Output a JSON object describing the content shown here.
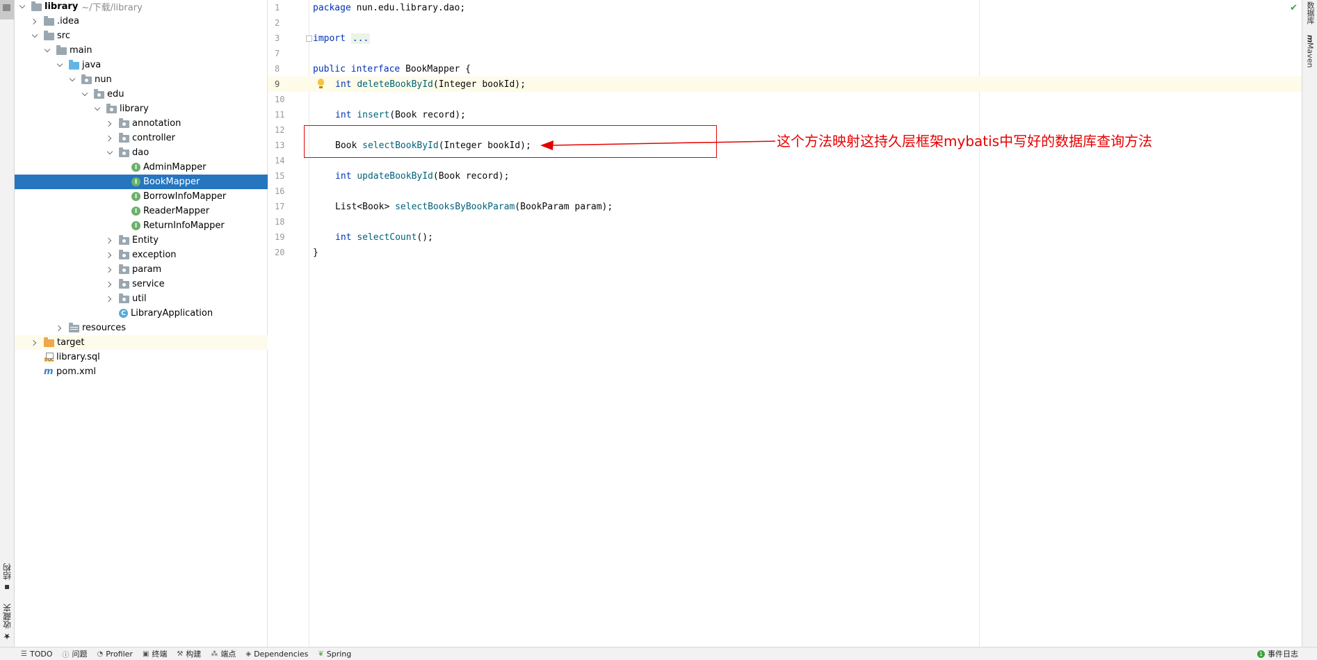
{
  "project_tree": {
    "root": {
      "label": "library",
      "path": "~/下载/library"
    },
    "items": [
      {
        "label": ".idea"
      },
      {
        "label": "src"
      },
      {
        "label": "main"
      },
      {
        "label": "java"
      },
      {
        "label": "nun"
      },
      {
        "label": "edu"
      },
      {
        "label": "library"
      },
      {
        "label": "annotation"
      },
      {
        "label": "controller"
      },
      {
        "label": "dao"
      },
      {
        "label": "AdminMapper"
      },
      {
        "label": "BookMapper"
      },
      {
        "label": "BorrowInfoMapper"
      },
      {
        "label": "ReaderMapper"
      },
      {
        "label": "ReturnInfoMapper"
      },
      {
        "label": "Entity"
      },
      {
        "label": "exception"
      },
      {
        "label": "param"
      },
      {
        "label": "service"
      },
      {
        "label": "util"
      },
      {
        "label": "LibraryApplication"
      },
      {
        "label": "resources"
      },
      {
        "label": "target"
      },
      {
        "label": "library.sql"
      },
      {
        "label": "pom.xml"
      }
    ]
  },
  "editor": {
    "lines": [
      {
        "n": "1"
      },
      {
        "n": "2"
      },
      {
        "n": "3"
      },
      {
        "n": "7"
      },
      {
        "n": "8"
      },
      {
        "n": "9"
      },
      {
        "n": "10"
      },
      {
        "n": "11"
      },
      {
        "n": "12"
      },
      {
        "n": "13"
      },
      {
        "n": "14"
      },
      {
        "n": "15"
      },
      {
        "n": "16"
      },
      {
        "n": "17"
      },
      {
        "n": "18"
      },
      {
        "n": "19"
      },
      {
        "n": "20"
      }
    ],
    "tokens": {
      "package_kw": "package",
      "package_name": " nun.edu.library.dao;",
      "import_kw": "import",
      "import_folded": "...",
      "public_kw": "public",
      "interface_kw": "interface",
      "class_decl": " BookMapper {",
      "int_kw": "int",
      "delete_fn": "deleteBookById",
      "delete_args": "(Integer bookId);",
      "insert_fn": "insert",
      "insert_args": "(Book record);",
      "book_type": "Book",
      "select_fn": "selectBookById",
      "select_args": "(Integer bookId);",
      "update_fn": "updateBookById",
      "update_args": "(Book record);",
      "list_type": "List<Book>",
      "select_param_fn": "selectBooksByBookParam",
      "select_param_args": "(BookParam param);",
      "count_fn": "selectCount",
      "count_args": "();",
      "close_brace": "}"
    }
  },
  "annotation": {
    "text": "这个方法映射这持久层框架mybatis中写好的数据库查询方法",
    "color": "#e60000"
  },
  "left_tabs": {
    "structure": "结构",
    "favorites": "收藏夹"
  },
  "right_tabs": {
    "database": "数据库",
    "maven": "Maven"
  },
  "statusbar": {
    "todo": "TODO",
    "problems": "问题",
    "profiler": "Profiler",
    "terminal": "终端",
    "build": "构建",
    "endpoints": "端点",
    "dependencies": "Dependencies",
    "spring": "Spring",
    "event_log": "事件日志",
    "event_count": "1"
  }
}
